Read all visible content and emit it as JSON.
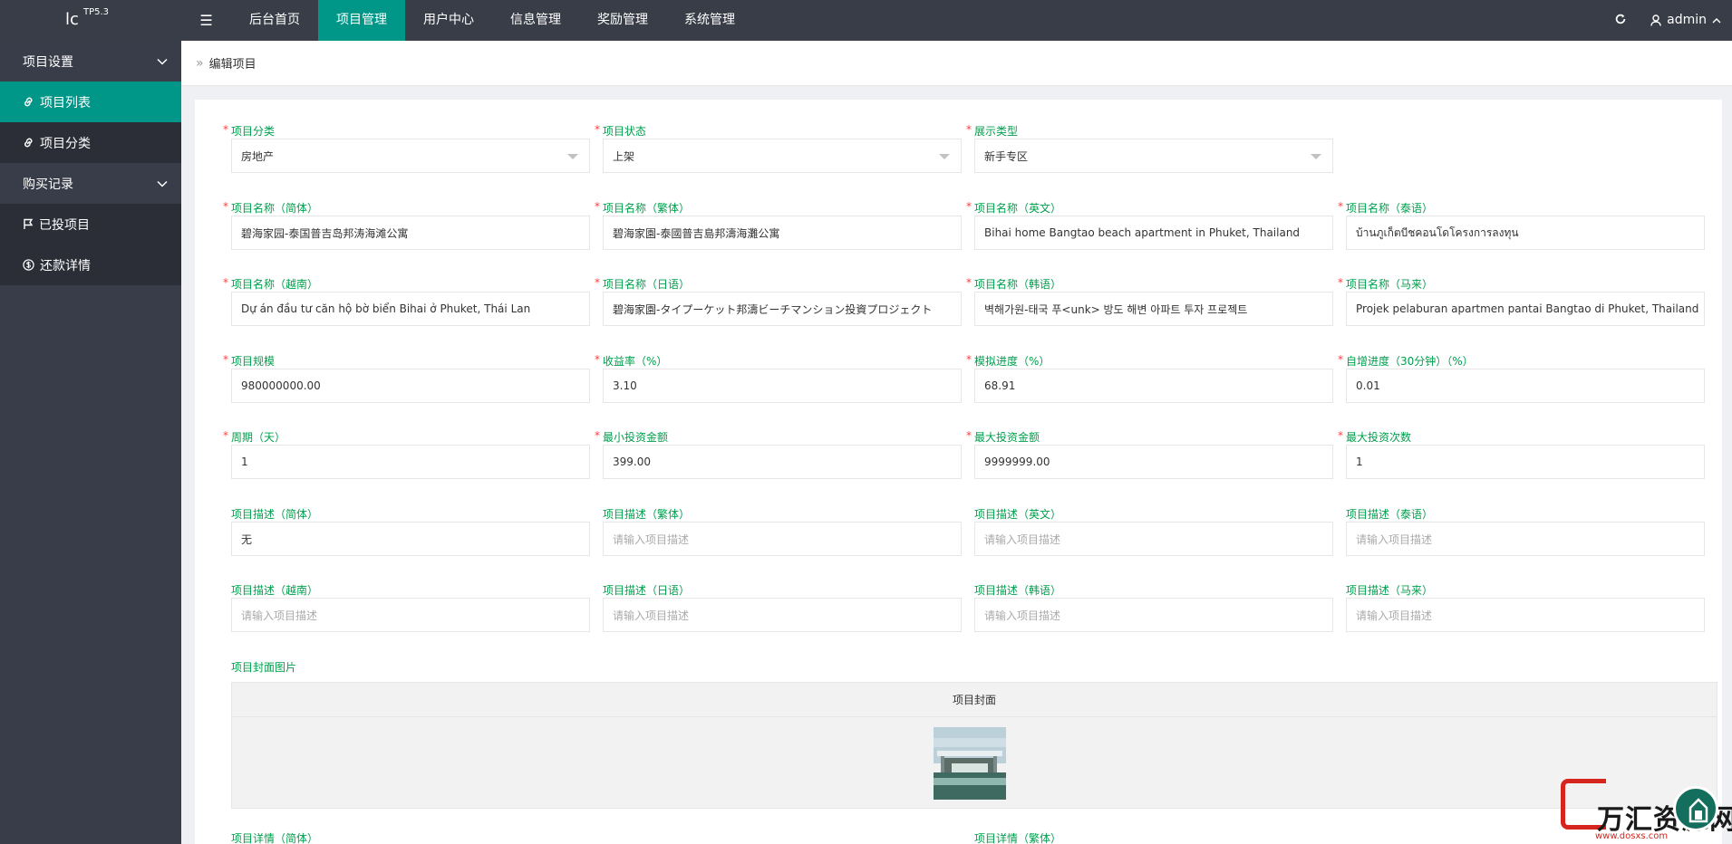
{
  "header": {
    "logo_text": "lc",
    "logo_version": "TP5.3",
    "menu_toggle": "☰",
    "nav": [
      {
        "label": "后台首页",
        "active": false
      },
      {
        "label": "项目管理",
        "active": true
      },
      {
        "label": "用户中心",
        "active": false
      },
      {
        "label": "信息管理",
        "active": false
      },
      {
        "label": "奖励管理",
        "active": false
      },
      {
        "label": "系统管理",
        "active": false
      }
    ],
    "username": "admin"
  },
  "sidebar": {
    "groups": [
      {
        "label": "项目设置",
        "items": [
          {
            "label": "项目列表",
            "icon": "link-icon",
            "active": true
          },
          {
            "label": "项目分类",
            "icon": "link-icon",
            "active": false
          }
        ]
      },
      {
        "label": "购买记录",
        "items": [
          {
            "label": "已投项目",
            "icon": "flag-icon",
            "active": false
          },
          {
            "label": "还款详情",
            "icon": "dollar-circle-icon",
            "active": false
          }
        ]
      }
    ]
  },
  "breadcrumb": "编辑项目",
  "form": {
    "row1": [
      {
        "label": "项目分类",
        "required": true,
        "value": "房地产",
        "select": true
      },
      {
        "label": "项目状态",
        "required": true,
        "value": "上架",
        "select": true
      },
      {
        "label": "展示类型",
        "required": true,
        "value": "新手专区",
        "select": true
      }
    ],
    "row2": [
      {
        "label": "项目名称（简体）",
        "required": true,
        "value": "碧海家园-泰国普吉岛邦涛海滩公寓"
      },
      {
        "label": "项目名称（繁体）",
        "required": true,
        "value": "碧海家園-泰國普吉島邦濤海灘公寓"
      },
      {
        "label": "项目名称（英文）",
        "required": true,
        "value": "Bihai home Bangtao beach apartment in Phuket, Thailand"
      },
      {
        "label": "项目名称（泰语）",
        "required": true,
        "value": "บ้านภูเก็ตบีชคอนโดโครงการลงทุน"
      }
    ],
    "row3": [
      {
        "label": "项目名称（越南）",
        "required": true,
        "value": "Dự án đầu tư căn hộ bờ biển Bihai ở Phuket, Thái Lan"
      },
      {
        "label": "项目名称（日语）",
        "required": true,
        "value": "碧海家園-タイプーケット邦濤ビーチマンション投資プロジェクト"
      },
      {
        "label": "项目名称（韩语）",
        "required": true,
        "value": "벽해가원-태국 푸<unk> 방도 해변 아파트 투자 프로젝트"
      },
      {
        "label": "项目名称（马来）",
        "required": true,
        "value": "Projek pelaburan apartmen pantai Bangtao di Phuket, Thailand"
      }
    ],
    "row4": [
      {
        "label": "项目规模",
        "required": true,
        "value": "980000000.00"
      },
      {
        "label": "收益率（%）",
        "required": true,
        "value": "3.10"
      },
      {
        "label": "模拟进度（%）",
        "required": true,
        "value": "68.91"
      },
      {
        "label": "自增进度（30分钟）（%）",
        "required": true,
        "value": "0.01"
      }
    ],
    "row5": [
      {
        "label": "周期（天）",
        "required": true,
        "value": "1"
      },
      {
        "label": "最小投资金额",
        "required": true,
        "value": "399.00"
      },
      {
        "label": "最大投资金额",
        "required": true,
        "value": "9999999.00"
      },
      {
        "label": "最大投资次数",
        "required": true,
        "value": "1"
      }
    ],
    "row6": [
      {
        "label": "项目描述（简体）",
        "required": false,
        "value": "无"
      },
      {
        "label": "项目描述（繁体）",
        "required": false,
        "placeholder": "请输入项目描述"
      },
      {
        "label": "项目描述（英文）",
        "required": false,
        "placeholder": "请输入项目描述"
      },
      {
        "label": "项目描述（泰语）",
        "required": false,
        "placeholder": "请输入项目描述"
      }
    ],
    "row7": [
      {
        "label": "项目描述（越南）",
        "required": false,
        "placeholder": "请输入项目描述"
      },
      {
        "label": "项目描述（日语）",
        "required": false,
        "placeholder": "请输入项目描述"
      },
      {
        "label": "项目描述（韩语）",
        "required": false,
        "placeholder": "请输入项目描述"
      },
      {
        "label": "项目描述（马来）",
        "required": false,
        "placeholder": "请输入项目描述"
      }
    ],
    "cover_label": "项目封面图片",
    "cover_header": "项目封面",
    "detail_labels": [
      "项目详情（简体）",
      "项目详情（繁体）"
    ]
  },
  "watermark": {
    "text": "万汇资源网",
    "url": "www.dosxs.com"
  },
  "colors": {
    "header_bg": "#383d47",
    "sidebar_bg": "#393d49",
    "accent": "#009688",
    "label_green": "#009f4d",
    "required_red": "#ff3f3f"
  }
}
